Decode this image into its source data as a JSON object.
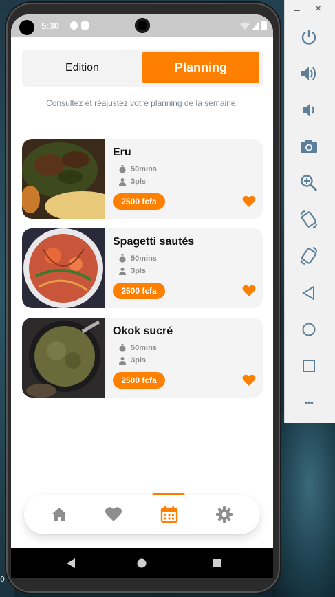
{
  "status_bar": {
    "time": "5:30"
  },
  "segmented": {
    "edition": "Edition",
    "planning": "Planning",
    "active": "planning"
  },
  "subtitle": "Consultez et réajustez votre planning de la semaine.",
  "recipes": [
    {
      "name": "Eru",
      "duration": "50mins",
      "servings": "3pls",
      "price": "2500 fcfa",
      "favorite": true
    },
    {
      "name": "Spagetti sautés",
      "duration": "50mins",
      "servings": "3pls",
      "price": "2500 fcfa",
      "favorite": true
    },
    {
      "name": "Okok sucré",
      "duration": "50mins",
      "servings": "3pls",
      "price": "2500 fcfa",
      "favorite": true
    }
  ],
  "bottom_nav": {
    "items": [
      "home-icon",
      "heart-icon",
      "calendar-icon",
      "gear-icon"
    ],
    "active": "calendar-icon"
  },
  "emulator_panel": {
    "window_controls": {
      "minimize": "–",
      "close": "×"
    },
    "tools": [
      "power-icon",
      "volume-up-icon",
      "volume-down-icon",
      "camera-icon",
      "zoom-icon",
      "rotate-left-icon",
      "rotate-right-icon",
      "back-icon",
      "home-icon",
      "overview-icon",
      "more-icon"
    ],
    "more_label": "•••"
  },
  "background": {
    "edge_char": "0"
  },
  "colors": {
    "accent": "#FF8000",
    "muted_text": "#7D8791",
    "card_bg": "#F4F4F4"
  }
}
